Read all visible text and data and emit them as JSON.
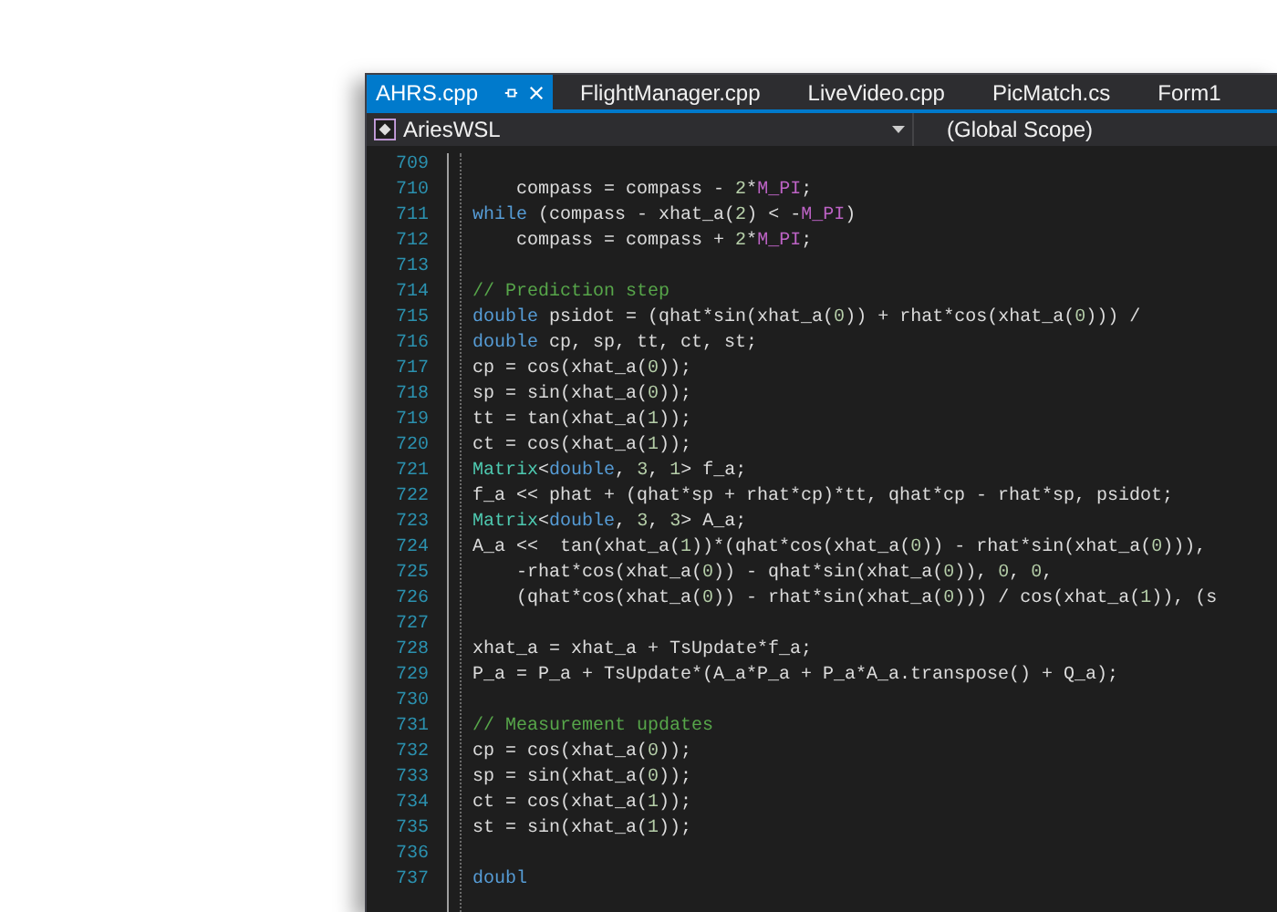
{
  "tabs": [
    {
      "label": "AHRS.cpp",
      "selected": true
    },
    {
      "label": "FlightManager.cpp",
      "selected": false
    },
    {
      "label": "LiveVideo.cpp",
      "selected": false
    },
    {
      "label": "PicMatch.cs",
      "selected": false
    },
    {
      "label": "Form1",
      "selected": false
    }
  ],
  "nav_bar": {
    "project": "AriesWSL",
    "scope": "(Global Scope)"
  },
  "editor": {
    "lines": [
      {
        "number": "709"
      },
      {
        "number": "710",
        "kind": "nested",
        "tokens": [
          {
            "text": "compass = compass - ",
            "kind": "plain"
          },
          {
            "text": "2",
            "kind": "number"
          },
          {
            "text": "*",
            "kind": "plain"
          },
          {
            "text": "M_PI",
            "kind": "macro"
          },
          {
            "text": ";",
            "kind": "plain"
          }
        ]
      },
      {
        "number": "711",
        "kind": "base",
        "tokens": [
          {
            "text": "while",
            "kind": "keyword"
          },
          {
            "text": " (compass - xhat_a(",
            "kind": "plain"
          },
          {
            "text": "2",
            "kind": "number"
          },
          {
            "text": ") < -",
            "kind": "plain"
          },
          {
            "text": "M_PI",
            "kind": "macro"
          },
          {
            "text": ")",
            "kind": "plain"
          }
        ]
      },
      {
        "number": "712",
        "kind": "nested",
        "tokens": [
          {
            "text": "compass = compass + ",
            "kind": "plain"
          },
          {
            "text": "2",
            "kind": "number"
          },
          {
            "text": "*",
            "kind": "plain"
          },
          {
            "text": "M_PI",
            "kind": "macro"
          },
          {
            "text": ";",
            "kind": "plain"
          }
        ]
      },
      {
        "number": "713"
      },
      {
        "number": "714",
        "kind": "base",
        "tokens": [
          {
            "text": "// Prediction step",
            "kind": "comment"
          }
        ]
      },
      {
        "number": "715",
        "kind": "base",
        "tokens": [
          {
            "text": "double",
            "kind": "keyword"
          },
          {
            "text": " psidot = (qhat*sin(xhat_a(",
            "kind": "plain"
          },
          {
            "text": "0",
            "kind": "number"
          },
          {
            "text": ")) + rhat*cos(xhat_a(",
            "kind": "plain"
          },
          {
            "text": "0",
            "kind": "number"
          },
          {
            "text": "))) /",
            "kind": "plain"
          }
        ]
      },
      {
        "number": "716",
        "kind": "base",
        "tokens": [
          {
            "text": "double",
            "kind": "keyword"
          },
          {
            "text": " cp, sp, tt, ct, st;",
            "kind": "plain"
          }
        ]
      },
      {
        "number": "717",
        "kind": "base",
        "tokens": [
          {
            "text": "cp = cos(xhat_a(",
            "kind": "plain"
          },
          {
            "text": "0",
            "kind": "number"
          },
          {
            "text": "));",
            "kind": "plain"
          }
        ]
      },
      {
        "number": "718",
        "kind": "base",
        "tokens": [
          {
            "text": "sp = sin(xhat_a(",
            "kind": "plain"
          },
          {
            "text": "0",
            "kind": "number"
          },
          {
            "text": "));",
            "kind": "plain"
          }
        ]
      },
      {
        "number": "719",
        "kind": "base",
        "tokens": [
          {
            "text": "tt = tan(xhat_a(",
            "kind": "plain"
          },
          {
            "text": "1",
            "kind": "number"
          },
          {
            "text": "));",
            "kind": "plain"
          }
        ]
      },
      {
        "number": "720",
        "kind": "base",
        "tokens": [
          {
            "text": "ct = cos(xhat_a(",
            "kind": "plain"
          },
          {
            "text": "1",
            "kind": "number"
          },
          {
            "text": "));",
            "kind": "plain"
          }
        ]
      },
      {
        "number": "721",
        "kind": "base",
        "tokens": [
          {
            "text": "Matrix",
            "kind": "type"
          },
          {
            "text": "<",
            "kind": "plain"
          },
          {
            "text": "double",
            "kind": "keyword"
          },
          {
            "text": ", ",
            "kind": "plain"
          },
          {
            "text": "3",
            "kind": "number"
          },
          {
            "text": ", ",
            "kind": "plain"
          },
          {
            "text": "1",
            "kind": "number"
          },
          {
            "text": "> f_a;",
            "kind": "plain"
          }
        ]
      },
      {
        "number": "722",
        "kind": "base",
        "tokens": [
          {
            "text": "f_a << phat + (qhat*sp + rhat*cp)*tt, qhat*cp - rhat*sp, psidot;",
            "kind": "plain"
          }
        ]
      },
      {
        "number": "723",
        "kind": "base",
        "tokens": [
          {
            "text": "Matrix",
            "kind": "type"
          },
          {
            "text": "<",
            "kind": "plain"
          },
          {
            "text": "double",
            "kind": "keyword"
          },
          {
            "text": ", ",
            "kind": "plain"
          },
          {
            "text": "3",
            "kind": "number"
          },
          {
            "text": ", ",
            "kind": "plain"
          },
          {
            "text": "3",
            "kind": "number"
          },
          {
            "text": "> A_a;",
            "kind": "plain"
          }
        ]
      },
      {
        "number": "724",
        "kind": "base",
        "tokens": [
          {
            "text": "A_a <<  tan(xhat_a(",
            "kind": "plain"
          },
          {
            "text": "1",
            "kind": "number"
          },
          {
            "text": "))*(qhat*cos(xhat_a(",
            "kind": "plain"
          },
          {
            "text": "0",
            "kind": "number"
          },
          {
            "text": ")) - rhat*sin(xhat_a(",
            "kind": "plain"
          },
          {
            "text": "0",
            "kind": "number"
          },
          {
            "text": "))),",
            "kind": "plain"
          }
        ]
      },
      {
        "number": "725",
        "kind": "nested",
        "tokens": [
          {
            "text": "-rhat*cos(xhat_a(",
            "kind": "plain"
          },
          {
            "text": "0",
            "kind": "number"
          },
          {
            "text": ")) - qhat*sin(xhat_a(",
            "kind": "plain"
          },
          {
            "text": "0",
            "kind": "number"
          },
          {
            "text": ")), ",
            "kind": "plain"
          },
          {
            "text": "0",
            "kind": "number"
          },
          {
            "text": ", ",
            "kind": "plain"
          },
          {
            "text": "0",
            "kind": "number"
          },
          {
            "text": ",",
            "kind": "plain"
          }
        ]
      },
      {
        "number": "726",
        "kind": "nested",
        "tokens": [
          {
            "text": "(qhat*cos(xhat_a(",
            "kind": "plain"
          },
          {
            "text": "0",
            "kind": "number"
          },
          {
            "text": ")) - rhat*sin(xhat_a(",
            "kind": "plain"
          },
          {
            "text": "0",
            "kind": "number"
          },
          {
            "text": "))) / cos(xhat_a(",
            "kind": "plain"
          },
          {
            "text": "1",
            "kind": "number"
          },
          {
            "text": ")), (s",
            "kind": "plain"
          }
        ]
      },
      {
        "number": "727"
      },
      {
        "number": "728",
        "kind": "base",
        "tokens": [
          {
            "text": "xhat_a = xhat_a + TsUpdate*f_a;",
            "kind": "plain"
          }
        ]
      },
      {
        "number": "729",
        "kind": "base",
        "tokens": [
          {
            "text": "P_a = P_a + TsUpdate*(A_a*P_a + P_a*A_a.transpose() + Q_a);",
            "kind": "plain"
          }
        ]
      },
      {
        "number": "730"
      },
      {
        "number": "731",
        "kind": "base",
        "tokens": [
          {
            "text": "// Measurement updates",
            "kind": "comment"
          }
        ]
      },
      {
        "number": "732",
        "kind": "base",
        "tokens": [
          {
            "text": "cp = cos(xhat_a(",
            "kind": "plain"
          },
          {
            "text": "0",
            "kind": "number"
          },
          {
            "text": "));",
            "kind": "plain"
          }
        ]
      },
      {
        "number": "733",
        "kind": "base",
        "tokens": [
          {
            "text": "sp = sin(xhat_a(",
            "kind": "plain"
          },
          {
            "text": "0",
            "kind": "number"
          },
          {
            "text": "));",
            "kind": "plain"
          }
        ]
      },
      {
        "number": "734",
        "kind": "base",
        "tokens": [
          {
            "text": "ct = cos(xhat_a(",
            "kind": "plain"
          },
          {
            "text": "1",
            "kind": "number"
          },
          {
            "text": "));",
            "kind": "plain"
          }
        ]
      },
      {
        "number": "735",
        "kind": "base",
        "tokens": [
          {
            "text": "st = sin(xhat_a(",
            "kind": "plain"
          },
          {
            "text": "1",
            "kind": "number"
          },
          {
            "text": "));",
            "kind": "plain"
          }
        ]
      },
      {
        "number": "736"
      },
      {
        "number": "737",
        "kind": "base",
        "tokens": [
          {
            "text": "doubl",
            "kind": "keyword"
          }
        ]
      }
    ]
  }
}
